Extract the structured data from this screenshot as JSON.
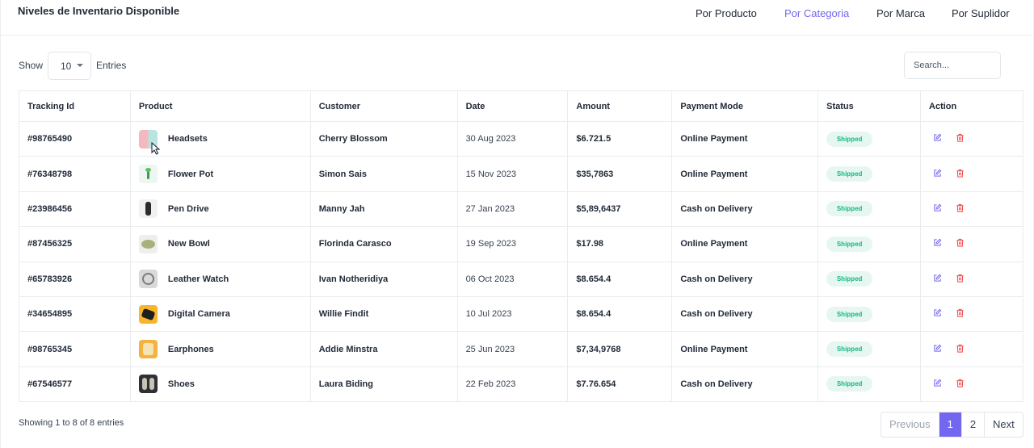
{
  "header": {
    "title": "Niveles de Inventario Disponible",
    "tabs": [
      {
        "label": "Por Producto",
        "active": false
      },
      {
        "label": "Por Categoria",
        "active": true
      },
      {
        "label": "Por Marca",
        "active": false
      },
      {
        "label": "Por Suplidor",
        "active": false
      }
    ],
    "accent_color": "#7367f0"
  },
  "controls": {
    "show_label": "Show",
    "entries_value": "10",
    "entries_label": "Entries",
    "search_placeholder": "Search..."
  },
  "table": {
    "columns": [
      "Tracking Id",
      "Product",
      "Customer",
      "Date",
      "Amount",
      "Payment Mode",
      "Status",
      "Action"
    ],
    "rows": [
      {
        "id": "#98765490",
        "product": "Headsets",
        "customer": "Cherry Blossom",
        "date": "30 Aug 2023",
        "amount": "$6.721.5",
        "payment": "Online Payment",
        "status": "Shipped"
      },
      {
        "id": "#76348798",
        "product": "Flower Pot",
        "customer": "Simon Sais",
        "date": "15 Nov 2023",
        "amount": "$35,7863",
        "payment": "Online Payment",
        "status": "Shipped"
      },
      {
        "id": "#23986456",
        "product": "Pen Drive",
        "customer": "Manny Jah",
        "date": "27 Jan 2023",
        "amount": "$5,89,6437",
        "payment": "Cash on Delivery",
        "status": "Shipped"
      },
      {
        "id": "#87456325",
        "product": "New Bowl",
        "customer": "Florinda Carasco",
        "date": "19 Sep 2023",
        "amount": "$17.98",
        "payment": "Online Payment",
        "status": "Shipped"
      },
      {
        "id": "#65783926",
        "product": "Leather Watch",
        "customer": "Ivan Notheridiya",
        "date": "06 Oct 2023",
        "amount": "$8.654.4",
        "payment": "Cash on Delivery",
        "status": "Shipped"
      },
      {
        "id": "#34654895",
        "product": "Digital Camera",
        "customer": "Willie Findit",
        "date": "10 Jul 2023",
        "amount": "$8.654.4",
        "payment": "Cash on Delivery",
        "status": "Shipped"
      },
      {
        "id": "#98765345",
        "product": "Earphones",
        "customer": "Addie Minstra",
        "date": "25 Jun 2023",
        "amount": "$7,34,9768",
        "payment": "Online Payment",
        "status": "Shipped"
      },
      {
        "id": "#67546577",
        "product": "Shoes",
        "customer": "Laura Biding",
        "date": "22 Feb 2023",
        "amount": "$7.76.654",
        "payment": "Cash on Delivery",
        "status": "Shipped"
      }
    ],
    "status_color": "#14b889",
    "edit_icon_color": "#7367f0",
    "delete_icon_color": "#ef4444"
  },
  "footer": {
    "info": "Showing 1 to 8 of 8 entries",
    "pages": [
      "Previous",
      "1",
      "2",
      "Next"
    ],
    "active_page": "1"
  }
}
